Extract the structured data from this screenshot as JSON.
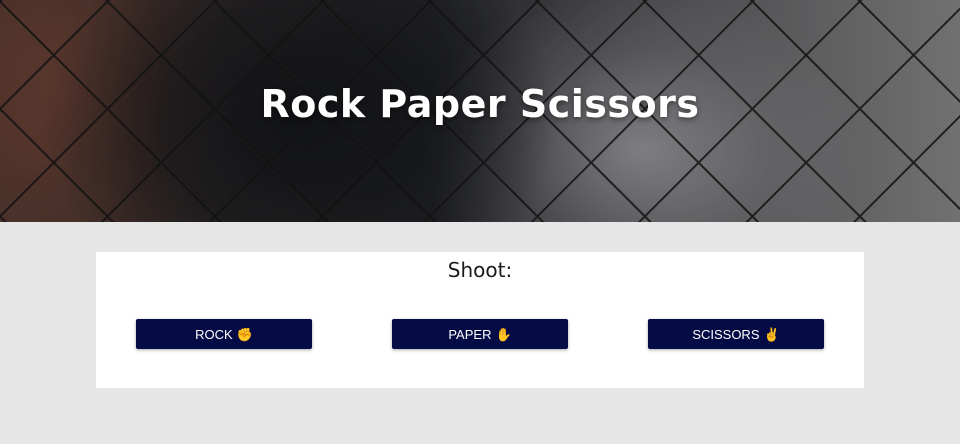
{
  "hero": {
    "title": "Rock Paper Scissors"
  },
  "game": {
    "prompt": "Shoot:",
    "choices": [
      {
        "label": "ROCK",
        "icon": "hand-rock-icon",
        "glyph": "✊"
      },
      {
        "label": "PAPER",
        "icon": "hand-paper-icon",
        "glyph": "✋"
      },
      {
        "label": "SCISSORS",
        "icon": "hand-scissors-icon",
        "glyph": "✌"
      }
    ]
  },
  "colors": {
    "page_background": "#e6e6e6",
    "button_background": "#050c45",
    "button_text": "#ffffff",
    "panel_background": "#ffffff"
  }
}
